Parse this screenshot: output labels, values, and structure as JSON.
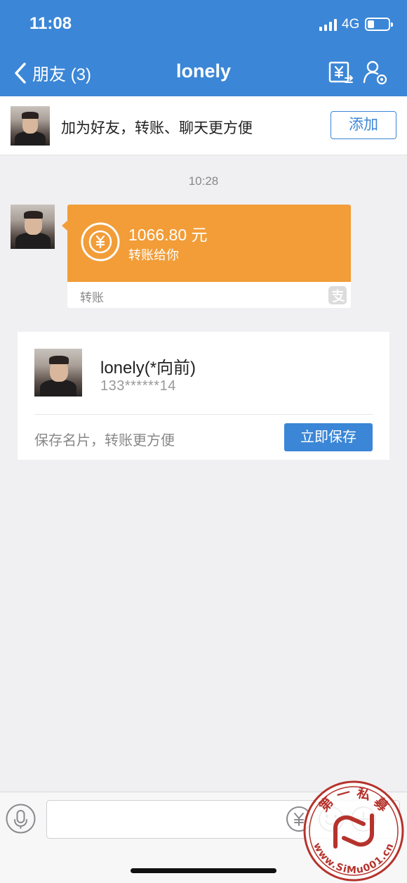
{
  "status_bar": {
    "time": "11:08",
    "network": "4G"
  },
  "nav": {
    "back_label": "朋友 (3)",
    "title": "lonely"
  },
  "add_friend_bar": {
    "text": "加为好友，转账、聊天更方便",
    "button_label": "添加"
  },
  "chat": {
    "timestamp": "10:28",
    "transfer": {
      "amount": "1066.80 元",
      "description": "转账给你",
      "type_label": "转账"
    }
  },
  "contact_card": {
    "name": "lonely(*向前)",
    "phone": "133******14",
    "hint": "保存名片，转账更方便",
    "save_label": "立即保存"
  },
  "watermark": {
    "text": "第 一 私 募",
    "url": "www.SiMu001.cn"
  },
  "colors": {
    "header": "#3b86d6",
    "transfer_orange": "#f29d38",
    "button_blue": "#3b86d6"
  }
}
